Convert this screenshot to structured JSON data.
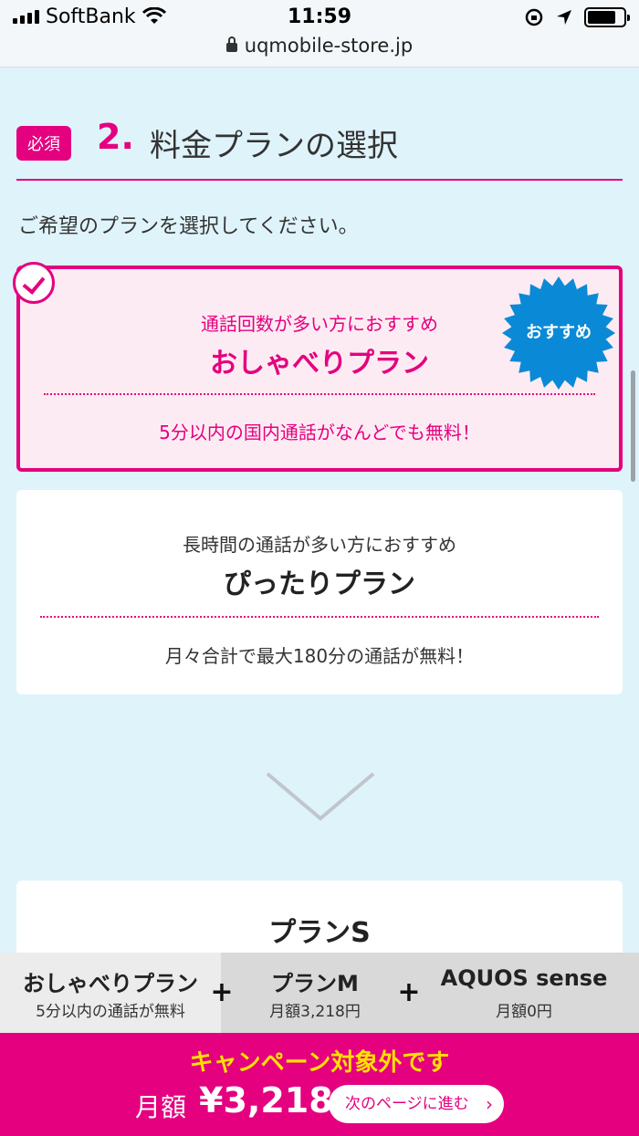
{
  "status_bar": {
    "carrier": "SoftBank",
    "time": "11:59",
    "url": "uqmobile-store.jp"
  },
  "section": {
    "required_badge": "必須",
    "step_number": "2.",
    "title": "料金プランの選択",
    "instruction": "ご希望のプランを選択してください。"
  },
  "plans": [
    {
      "lead": "通話回数が多い方におすすめ",
      "name": "おしゃべりプラン",
      "desc": "5分以内の国内通話がなんどでも無料！",
      "selected": true,
      "badge": "おすすめ"
    },
    {
      "lead": "長時間の通話が多い方におすすめ",
      "name": "ぴったりプラン",
      "desc": "月々合計で最大180分の通話が無料！",
      "selected": false
    }
  ],
  "next_section": {
    "plan_title": "プランS"
  },
  "summary": [
    {
      "main": "おしゃべりプラン",
      "sub": "5分以内の通話が無料"
    },
    {
      "main": "プランM",
      "sub": "月額3,218円"
    },
    {
      "main": "AQUOS sense",
      "sub": "月額0円"
    }
  ],
  "footer": {
    "campaign": "キャンペーン対象外です",
    "price_label": "月額",
    "price_value": "¥3,218",
    "next_button": "次のページに進む",
    "next_chevron": "›"
  },
  "colors": {
    "accent": "#e4007f",
    "background": "#dff3fb",
    "badge_blue": "#0a8ad6",
    "campaign_yellow": "#ffe100"
  },
  "icons": [
    "wifi-icon",
    "lock-icon",
    "battery-icon",
    "check-icon",
    "chevron-down-icon"
  ]
}
